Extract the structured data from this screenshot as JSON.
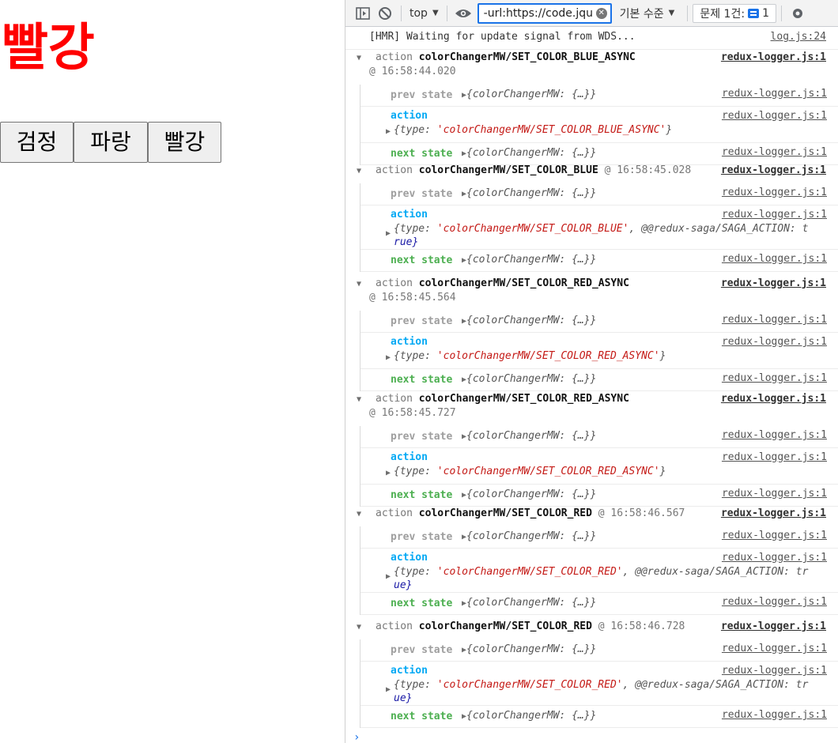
{
  "page": {
    "heading": "빨강",
    "heading_color": "#ff0000",
    "buttons": [
      "검정",
      "파랑",
      "빨강"
    ]
  },
  "devtools": {
    "context": "top",
    "filter_value": "-url:https://code.jque",
    "level": "기본 수준",
    "issues_label": "문제 1건:",
    "issues_count": "1",
    "hmr_message": "[HMR] Waiting for update signal from WDS...",
    "hmr_source": "log.js:24",
    "logger_source": "redux-logger.js:1",
    "prev_label": "prev state",
    "action_label": "action",
    "next_label": "next state",
    "state_text": "{colorChangerMW: {…}}",
    "groups": [
      {
        "head_word": "action",
        "type": "colorChangerMW/SET_COLOR_BLUE_ASYNC",
        "time": "@ 16:58:44.020",
        "action_prefix": "{type: ",
        "action_type": "'colorChangerMW/SET_COLOR_BLUE_ASYNC'",
        "action_suffix": "}",
        "action_suffix2": ""
      },
      {
        "head_word": "action",
        "type": "colorChangerMW/SET_COLOR_BLUE",
        "time": "@ 16:58:45.028",
        "action_prefix": "{type: ",
        "action_type": "'colorChangerMW/SET_COLOR_BLUE'",
        "action_suffix": ", @@redux-saga/SAGA_ACTION: t",
        "action_suffix2": "rue}"
      },
      {
        "head_word": "action",
        "type": "colorChangerMW/SET_COLOR_RED_ASYNC",
        "time": "@ 16:58:45.564",
        "action_prefix": "{type: ",
        "action_type": "'colorChangerMW/SET_COLOR_RED_ASYNC'",
        "action_suffix": "}",
        "action_suffix2": ""
      },
      {
        "head_word": "action",
        "type": "colorChangerMW/SET_COLOR_RED_ASYNC",
        "time": "@ 16:58:45.727",
        "action_prefix": "{type: ",
        "action_type": "'colorChangerMW/SET_COLOR_RED_ASYNC'",
        "action_suffix": "}",
        "action_suffix2": ""
      },
      {
        "head_word": "action",
        "type": "colorChangerMW/SET_COLOR_RED",
        "time": "@ 16:58:46.567",
        "action_prefix": "{type: ",
        "action_type": "'colorChangerMW/SET_COLOR_RED'",
        "action_suffix": ", @@redux-saga/SAGA_ACTION: tr",
        "action_suffix2": "ue}"
      },
      {
        "head_word": "action",
        "type": "colorChangerMW/SET_COLOR_RED",
        "time": "@ 16:58:46.728",
        "action_prefix": "{type: ",
        "action_type": "'colorChangerMW/SET_COLOR_RED'",
        "action_suffix": ", @@redux-saga/SAGA_ACTION: tr",
        "action_suffix2": "ue}"
      }
    ],
    "prompt": "›"
  }
}
